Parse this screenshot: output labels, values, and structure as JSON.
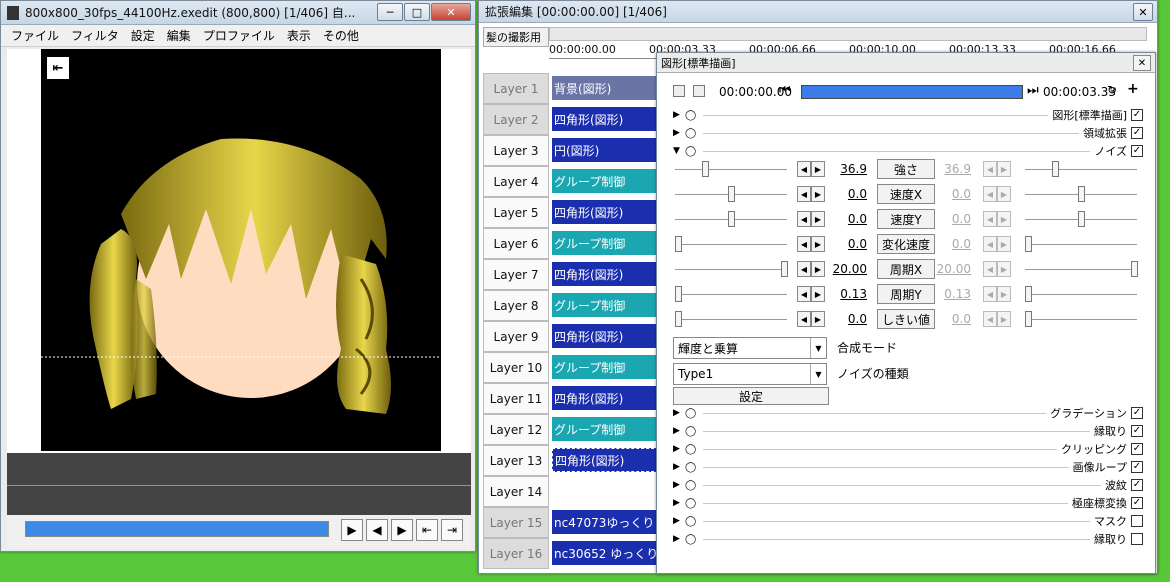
{
  "main_window": {
    "title": "800x800_30fps_44100Hz.exedit (800,800)  [1/406]  自...",
    "menu": [
      "ファイル",
      "フィルタ",
      "設定",
      "編集",
      "プロファイル",
      "表示",
      "その他"
    ]
  },
  "timeline_window": {
    "title": "拡張編集 [00:00:00.00] [1/406]",
    "scene_label": "髪の撮影用",
    "ruler": [
      "00:00:00.00",
      "00:00:03.33",
      "00:00:06.66",
      "00:00:10.00",
      "00:00:13.33",
      "00:00:16.66"
    ],
    "layers": [
      {
        "label": "Layer  1",
        "dim": true,
        "clip": "背景(図形)",
        "clip_type": "dark"
      },
      {
        "label": "Layer  2",
        "dim": true,
        "clip": "四角形(図形)",
        "clip_type": "blue"
      },
      {
        "label": "Layer  3",
        "dim": false,
        "clip": "円(図形)",
        "clip_type": "blue"
      },
      {
        "label": "Layer  4",
        "dim": false,
        "clip": "グループ制御",
        "clip_type": "teal"
      },
      {
        "label": "Layer  5",
        "dim": false,
        "clip": "四角形(図形)",
        "clip_type": "blue"
      },
      {
        "label": "Layer  6",
        "dim": false,
        "clip": "グループ制御",
        "clip_type": "teal"
      },
      {
        "label": "Layer  7",
        "dim": false,
        "clip": "四角形(図形)",
        "clip_type": "blue"
      },
      {
        "label": "Layer  8",
        "dim": false,
        "clip": "グループ制御",
        "clip_type": "teal"
      },
      {
        "label": "Layer  9",
        "dim": false,
        "clip": "四角形(図形)",
        "clip_type": "blue"
      },
      {
        "label": "Layer 10",
        "dim": false,
        "clip": "グループ制御",
        "clip_type": "teal"
      },
      {
        "label": "Layer 11",
        "dim": false,
        "clip": "四角形(図形)",
        "clip_type": "blue"
      },
      {
        "label": "Layer 12",
        "dim": false,
        "clip": "グループ制御",
        "clip_type": "teal"
      },
      {
        "label": "Layer 13",
        "dim": false,
        "clip": "四角形(図形)",
        "clip_type": "blue sel"
      },
      {
        "label": "Layer 14",
        "dim": false,
        "clip": "",
        "clip_type": ""
      },
      {
        "label": "Layer 15",
        "dim": true,
        "clip": "nc47073ゆっくり",
        "clip_type": "blue"
      },
      {
        "label": "Layer 16",
        "dim": true,
        "clip": "nc30652 ゆっくり",
        "clip_type": "blue"
      }
    ]
  },
  "props": {
    "title": "図形[標準描画]",
    "time_start": "00:00:00.00",
    "time_end": "00:00:03.33",
    "top_filters": [
      {
        "label": "図形[標準描画]",
        "checked": true,
        "open": false
      },
      {
        "label": "領域拡張",
        "checked": true,
        "open": false
      },
      {
        "label": "ノイズ",
        "checked": true,
        "open": true
      }
    ],
    "params": [
      {
        "label": "強さ",
        "v1": "36.9",
        "v2": "36.9",
        "t1": 0.25,
        "t2": 0.25
      },
      {
        "label": "速度X",
        "v1": "0.0",
        "v2": "0.0",
        "t1": 0.5,
        "t2": 0.5
      },
      {
        "label": "速度Y",
        "v1": "0.0",
        "v2": "0.0",
        "t1": 0.5,
        "t2": 0.5
      },
      {
        "label": "変化速度",
        "v1": "0.0",
        "v2": "0.0",
        "t1": 0.0,
        "t2": 0.0
      },
      {
        "label": "周期X",
        "v1": "20.00",
        "v2": "20.00",
        "t1": 1.0,
        "t2": 1.0
      },
      {
        "label": "周期Y",
        "v1": "0.13",
        "v2": "0.13",
        "t1": 0.0,
        "t2": 0.0
      },
      {
        "label": "しきい値",
        "v1": "0.0",
        "v2": "0.0",
        "t1": 0.0,
        "t2": 0.0
      }
    ],
    "blend_mode": {
      "value": "輝度と乗算",
      "label": "合成モード"
    },
    "noise_type": {
      "value": "Type1",
      "label": "ノイズの種類"
    },
    "settings_button": "設定",
    "bottom_filters": [
      {
        "label": "グラデーション",
        "checked": true
      },
      {
        "label": "縁取り",
        "checked": true
      },
      {
        "label": "クリッピング",
        "checked": true
      },
      {
        "label": "画像ループ",
        "checked": true
      },
      {
        "label": "波紋",
        "checked": true
      },
      {
        "label": "極座標変換",
        "checked": true
      },
      {
        "label": "マスク",
        "checked": false
      },
      {
        "label": "縁取り",
        "checked": false
      }
    ]
  },
  "colors": {
    "clip_blue": "#1b2fae",
    "clip_teal": "#1aa7b1",
    "seek_blue": "#3a8ae6",
    "hair": "#c9b21c",
    "skin": "#ffdcc0"
  }
}
